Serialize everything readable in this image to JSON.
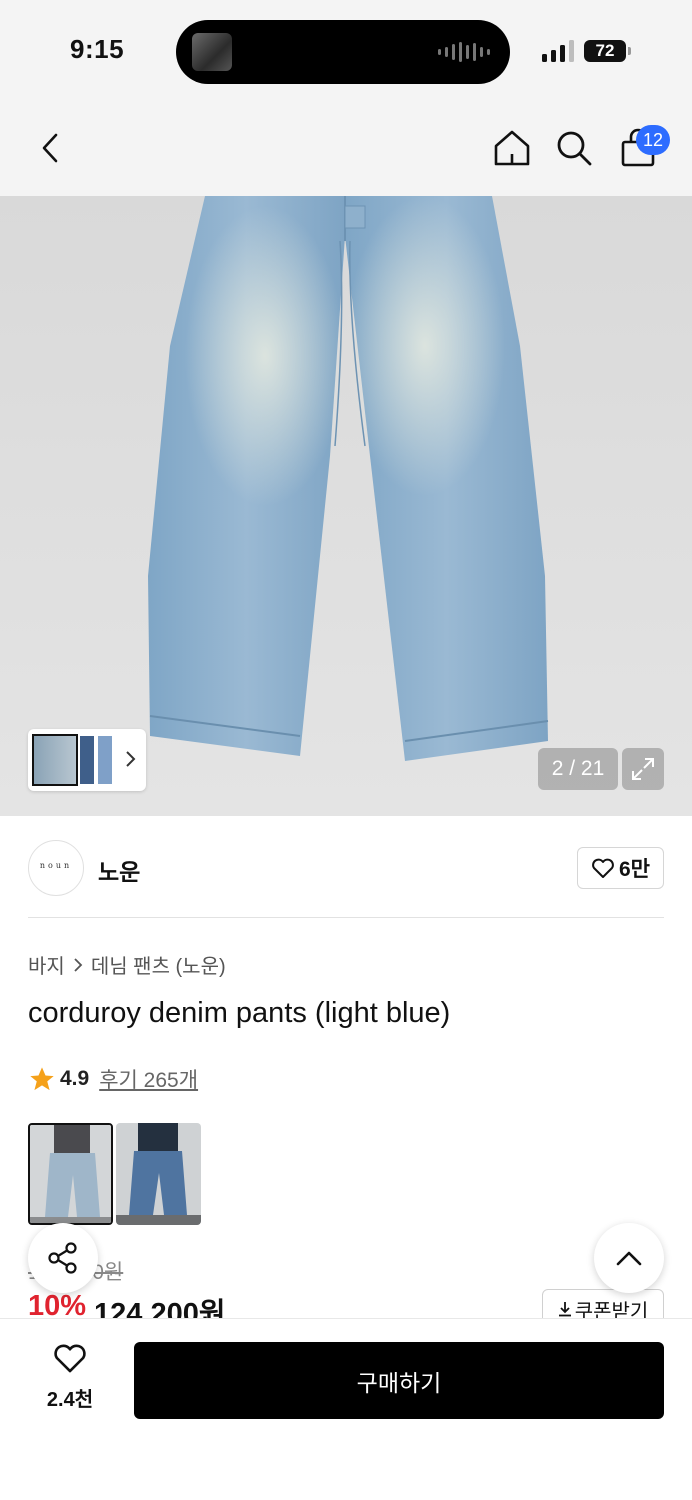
{
  "status_bar": {
    "time": "9:15",
    "battery": "72"
  },
  "header": {
    "cart_count": "12"
  },
  "gallery": {
    "counter": "2 / 21"
  },
  "brand": {
    "logo_text": "noun",
    "name": "노운",
    "likes": "6만"
  },
  "breadcrumb": {
    "category": "바지",
    "subcategory": "데님 팬츠 (노운)"
  },
  "product": {
    "title": "corduroy denim pants (light blue)",
    "rating": "4.9",
    "reviews": "후기 265개",
    "original_price": "138,000원",
    "discount": "10%",
    "sale_price": "124,200원"
  },
  "coupon": {
    "label": "쿠폰받기"
  },
  "bottom_bar": {
    "wish_count": "2.4천",
    "buy_label": "구매하기"
  },
  "colors": {
    "accent_blue": "#2d6cff",
    "discount_red": "#e0232f",
    "star": "#f5a11a"
  }
}
